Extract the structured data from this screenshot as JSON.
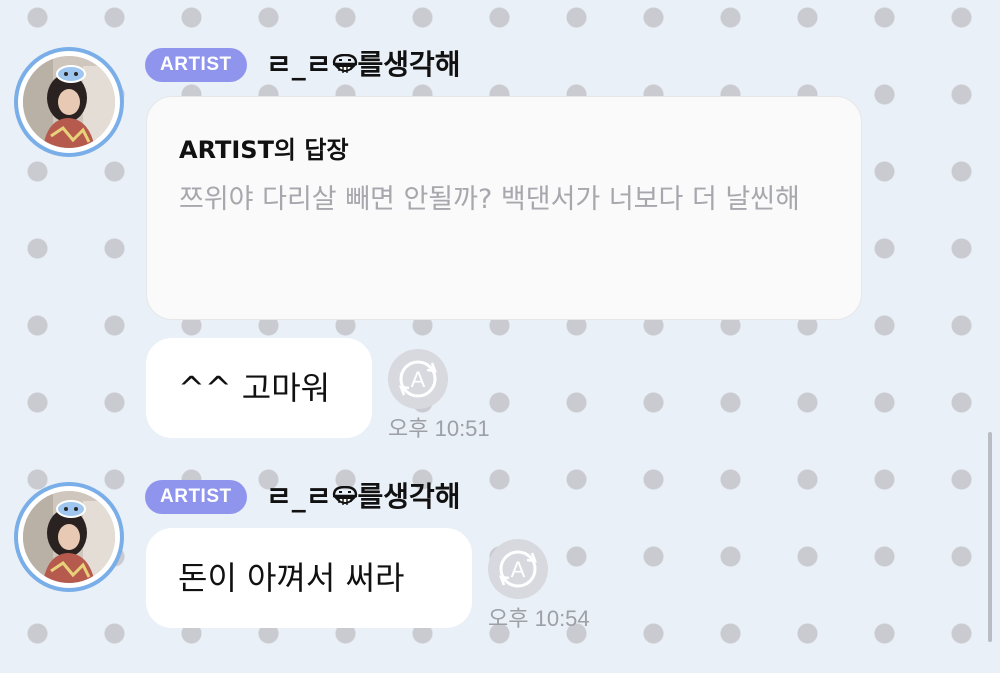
{
  "messages": [
    {
      "author_badge": "ARTIST",
      "nickname": "ㄹ_ㄹ",
      "nickname_icon": "grinning-face-icon",
      "nickname_suffix": "를생각해",
      "reply": {
        "title": "ARTIST의 답장",
        "body": "쯔위야 다리살 빼면 안될까? 백댄서가 너보다 더 날씬해"
      },
      "text": "^^ 고마워",
      "translate_icon": "translate-a-icon",
      "time": "오후 10:51"
    },
    {
      "author_badge": "ARTIST",
      "nickname": "ㄹ_ㄹ",
      "nickname_icon": "grinning-face-icon",
      "nickname_suffix": "를생각해",
      "text": "돈이 아껴서 써라",
      "translate_icon": "translate-a-icon",
      "time": "오후 10:54"
    }
  ],
  "colors": {
    "background": "#eaf0f7",
    "dot": "#c9cbd0",
    "badge": "#8f95ec",
    "avatar_ring": "#7aaee8",
    "timestamp": "#9da0a6",
    "reply_body": "#a7a7ad"
  }
}
